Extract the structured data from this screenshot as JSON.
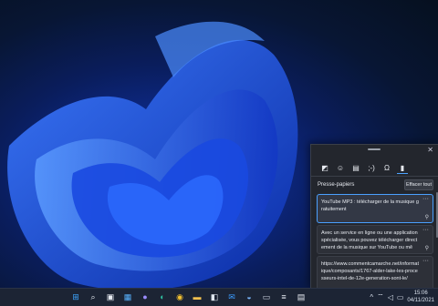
{
  "taskbar": {
    "icons": [
      "start-icon",
      "search-icon",
      "task-view-icon",
      "widgets-icon",
      "chat-icon",
      "edge-icon",
      "chrome-icon",
      "file-explorer-icon",
      "store-icon",
      "mail-icon",
      "photos-icon",
      "terminal-icon",
      "mixer-icon",
      "clipboard-app-icon"
    ],
    "clock": {
      "time": "15:06",
      "date": "04/11/2021"
    }
  },
  "clipboard": {
    "categories": [
      "sticker-icon",
      "emoji-icon",
      "gif-icon",
      "kaomoji-icon",
      "symbols-icon",
      "clipboard-history-icon"
    ],
    "selected_category": "clipboard-history-icon",
    "title": "Presse-papiers",
    "clear_all_label": "Effacer tout",
    "items": [
      {
        "text": "YouTube MP3 : télécharger de la musique gratuitement"
      },
      {
        "text": "Avec un service en ligne ou une application spécialisée, vous pouvez télécharger directement de la musique sur YouTube ou mê"
      },
      {
        "text": "https://www.commentcamarche.net/informatique/composants/1767-alder-lake-les-processeurs-intel-de-12e-generation-sont-le/"
      }
    ],
    "colors": {
      "accent": "#4aa0ff",
      "panel": "#23262d"
    }
  }
}
